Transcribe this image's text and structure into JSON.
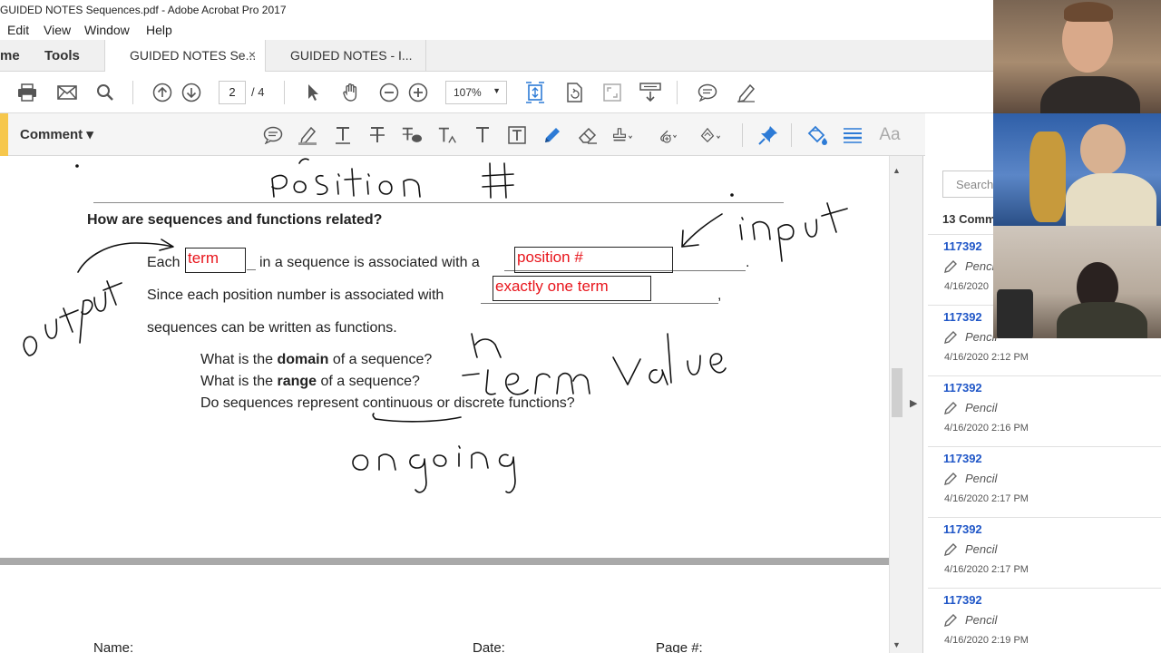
{
  "window": {
    "title": "GUIDED NOTES Sequences.pdf - Adobe Acrobat Pro 2017"
  },
  "menu": {
    "items": [
      "Edit",
      "View",
      "Window",
      "Help"
    ]
  },
  "tabs": {
    "home_label": "me",
    "tools_label": "Tools",
    "doc_tabs": [
      {
        "label": "GUIDED NOTES Se...",
        "active": true,
        "close": "×"
      },
      {
        "label": "GUIDED NOTES - I...",
        "active": false
      }
    ]
  },
  "toolbar": {
    "page_current": "2",
    "page_total": "/ 4",
    "zoom": "107%"
  },
  "comment_bar": {
    "label": "Comment ▾",
    "text_style_label": "Aa"
  },
  "document": {
    "heading": "How are sequences and functions related?",
    "line1_pre": "Each",
    "line1_box": "term",
    "line1_mid": "in a sequence is associated with a",
    "line1_box2": "position #",
    "line1_end": ".",
    "line2_pre": "Since each position number is associated with",
    "line2_box": "exactly one term",
    "line2_end": ",",
    "line3": "sequences can be written as functions.",
    "q1_pre": "What is the ",
    "q1_bold": "domain",
    "q1_post": " of a sequence?",
    "q2_pre": "What is the ",
    "q2_bold": "range",
    "q2_post": " of a sequence?",
    "q3": "Do sequences represent continuous or discrete functions?",
    "footer_name": "Name:",
    "footer_date": "Date:",
    "footer_page": "Page #:"
  },
  "comments_panel": {
    "search_placeholder": "Search",
    "count_label": "13 Comm",
    "items": [
      {
        "author": "117392",
        "kind": "Pencil",
        "time": "4/16/2020"
      },
      {
        "author": "117392",
        "kind": "Pencil",
        "time": "4/16/2020  2:12 PM"
      },
      {
        "author": "117392",
        "kind": "Pencil",
        "time": "4/16/2020  2:16 PM"
      },
      {
        "author": "117392",
        "kind": "Pencil",
        "time": "4/16/2020  2:17 PM"
      },
      {
        "author": "117392",
        "kind": "Pencil",
        "time": "4/16/2020  2:17 PM"
      },
      {
        "author": "117392",
        "kind": "Pencil",
        "time": "4/16/2020  2:19 PM"
      }
    ]
  },
  "colors": {
    "accent_yellow": "#f6c74c",
    "answer_red": "#e8141b",
    "link_blue": "#1f56c7",
    "toolbar_blue": "#2d7bd6"
  }
}
